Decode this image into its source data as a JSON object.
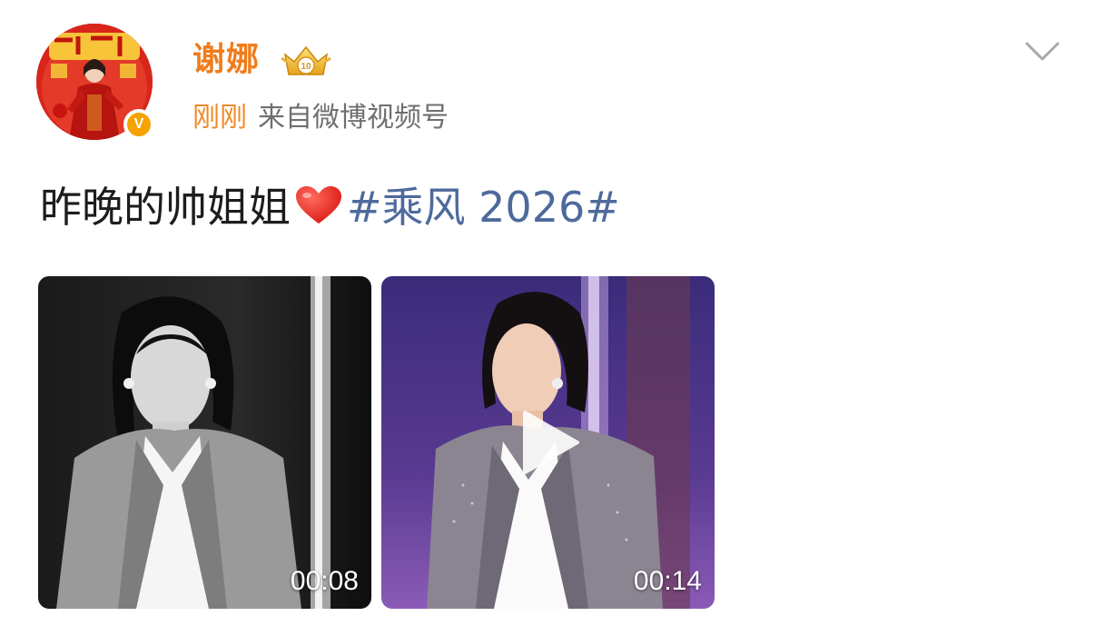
{
  "author": {
    "name": "谢娜",
    "avatar_label": "author-avatar",
    "verified_icon": "v-verified-icon",
    "member_badge_icon": "crown-level-badge-icon"
  },
  "meta": {
    "time": "刚刚",
    "source": "来自微博视频号"
  },
  "post": {
    "text": "昨晚的帅姐姐",
    "emoji": "heart-emoji",
    "topic": "#乘风 2026#"
  },
  "videos": [
    {
      "duration": "00:08",
      "style": "black-and-white"
    },
    {
      "duration": "00:14",
      "style": "color",
      "play_icon": "play-icon"
    }
  ],
  "colors": {
    "name": "#f07c1c",
    "time": "#f08a2a",
    "source": "#6f6f6f",
    "topic": "#4e6a9c",
    "text": "#1d1d1d",
    "verified": "#f5a300"
  },
  "menu_icon": "chevron-down-icon"
}
